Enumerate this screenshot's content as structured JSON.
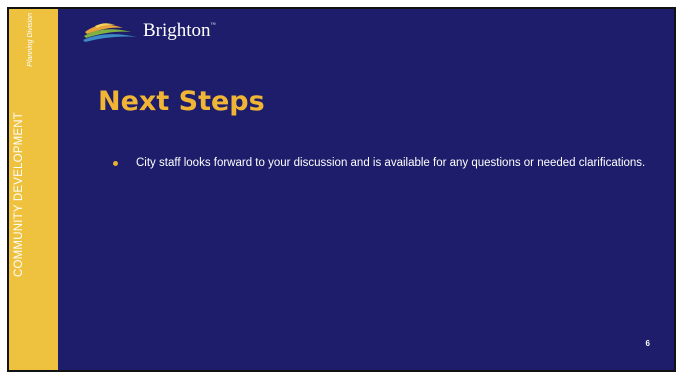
{
  "sidebar": {
    "title": "COMMUNITY DEVELOPMENT",
    "subtitle": "Planning Division"
  },
  "logo": {
    "name": "Brighton",
    "mark": "™"
  },
  "slide": {
    "title": "Next Steps",
    "bullets": [
      "City staff looks forward to your discussion and is available for any questions or needed clarifications."
    ],
    "page_number": "6"
  },
  "colors": {
    "background": "#1d1d6b",
    "sidebar": "#eec13e",
    "title": "#f1b535",
    "bullet": "#e8b034"
  }
}
